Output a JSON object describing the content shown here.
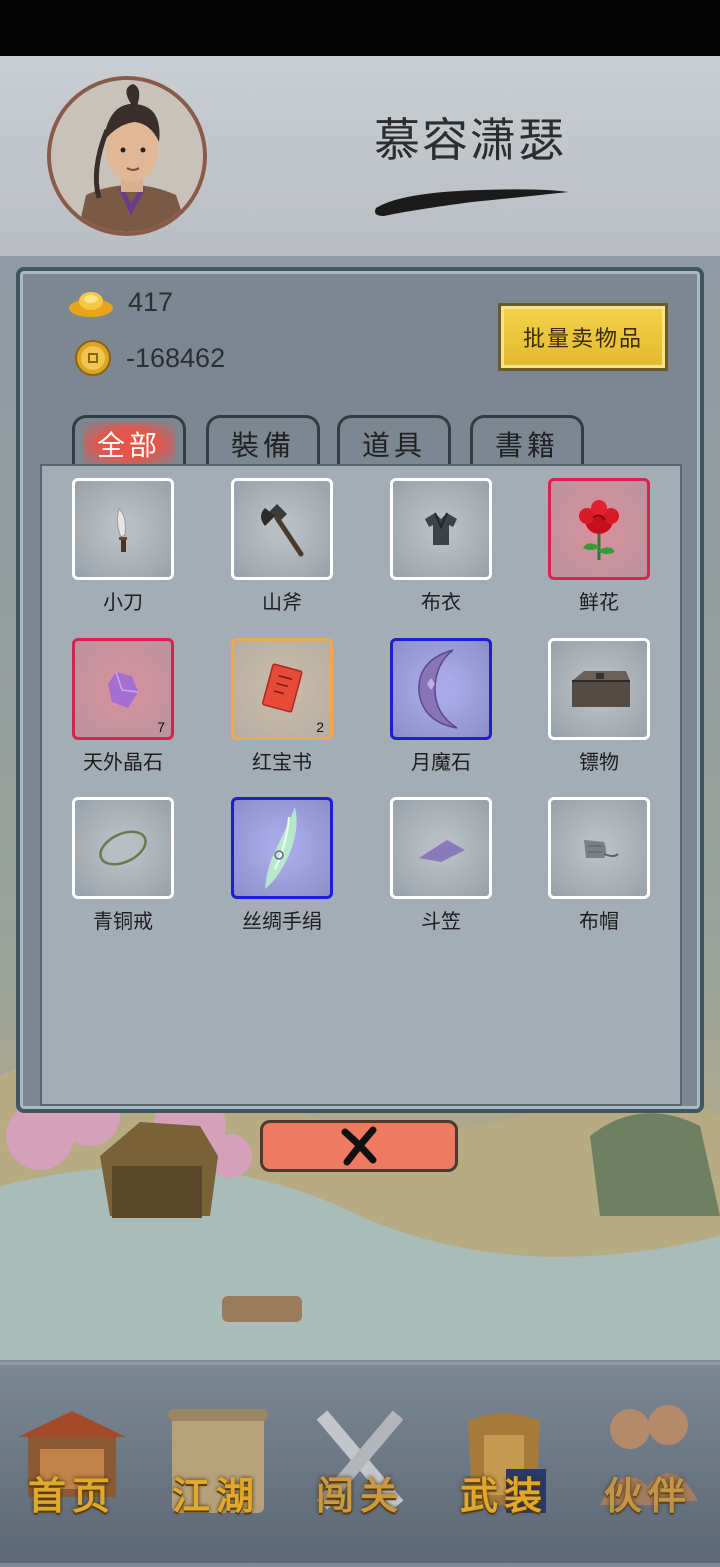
{
  "player": {
    "name": "慕容潇瑟"
  },
  "currency": {
    "gold": "417",
    "coins": "-168462"
  },
  "sell_button": {
    "label": "批量卖物品"
  },
  "tabs": [
    {
      "label": "全部",
      "active": true
    },
    {
      "label": "裝備"
    },
    {
      "label": "道具"
    },
    {
      "label": "書籍"
    }
  ],
  "items": [
    {
      "name": "小刀",
      "icon": "knife-icon",
      "rarity": "white"
    },
    {
      "name": "山斧",
      "icon": "axe-icon",
      "rarity": "white"
    },
    {
      "name": "布衣",
      "icon": "cloth-shirt-icon",
      "rarity": "white"
    },
    {
      "name": "鲜花",
      "icon": "rose-icon",
      "rarity": "red"
    },
    {
      "name": "天外晶石",
      "icon": "crystal-icon",
      "rarity": "red",
      "count": "7"
    },
    {
      "name": "红宝书",
      "icon": "red-book-icon",
      "rarity": "orange",
      "count": "2"
    },
    {
      "name": "月魔石",
      "icon": "crescent-moon-icon",
      "rarity": "blue"
    },
    {
      "name": "镖物",
      "icon": "chest-icon",
      "rarity": "white"
    },
    {
      "name": "青铜戒",
      "icon": "ring-icon",
      "rarity": "white"
    },
    {
      "name": "丝绸手绢",
      "icon": "silk-handkerchief-icon",
      "rarity": "blue"
    },
    {
      "name": "斗笠",
      "icon": "straw-hat-icon",
      "rarity": "white"
    },
    {
      "name": "布帽",
      "icon": "cloth-cap-icon",
      "rarity": "white"
    }
  ],
  "nav": [
    {
      "label": "首页"
    },
    {
      "label": "江湖"
    },
    {
      "label": "闯关"
    },
    {
      "label": "武装"
    },
    {
      "label": "伙伴"
    }
  ],
  "colors": {
    "rarity_red": "#d9234f",
    "rarity_orange": "#f0a84a",
    "rarity_blue": "#1d1dd4",
    "close_button": "#ee7a62",
    "sell_button": "#e9c43a"
  }
}
